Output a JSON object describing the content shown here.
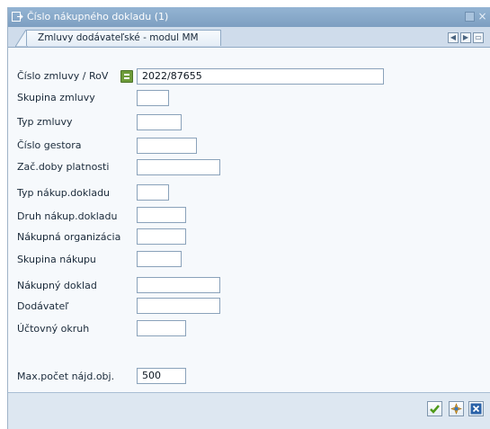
{
  "window": {
    "title": "Číslo nákupného dokladu (1)"
  },
  "tab": {
    "label": "Zmluvy dodávateľské - modul MM"
  },
  "fields": [
    {
      "label": "Číslo zmluvy / RoV",
      "value": "2022/87655"
    },
    {
      "label": "Skupina zmluvy",
      "value": ""
    },
    {
      "label": "Typ zmluvy",
      "value": ""
    },
    {
      "label": "Číslo gestora",
      "value": ""
    },
    {
      "label": "Zač.doby platnosti",
      "value": ""
    },
    {
      "label": "Typ nákup.dokladu",
      "value": ""
    },
    {
      "label": "Druh nákup.dokladu",
      "value": ""
    },
    {
      "label": "Nákupná organizácia",
      "value": ""
    },
    {
      "label": "Skupina nákupu",
      "value": ""
    },
    {
      "label": "Nákupný doklad",
      "value": ""
    },
    {
      "label": "Dodávateľ",
      "value": ""
    },
    {
      "label": "Účtovný okruh",
      "value": ""
    },
    {
      "label": "Max.počet nájd.obj.",
      "value": "500"
    }
  ],
  "icons": {
    "title": "dialog-icon",
    "match": "multiple-selection-icon",
    "confirm": "checkmark-icon",
    "find": "find-icon",
    "cancel": "cancel-icon"
  },
  "colors": {
    "titlebar": "#88a9ca",
    "background": "#f6f9fc",
    "confirm": "#4f9a1a",
    "cancel": "#2a62a8"
  }
}
